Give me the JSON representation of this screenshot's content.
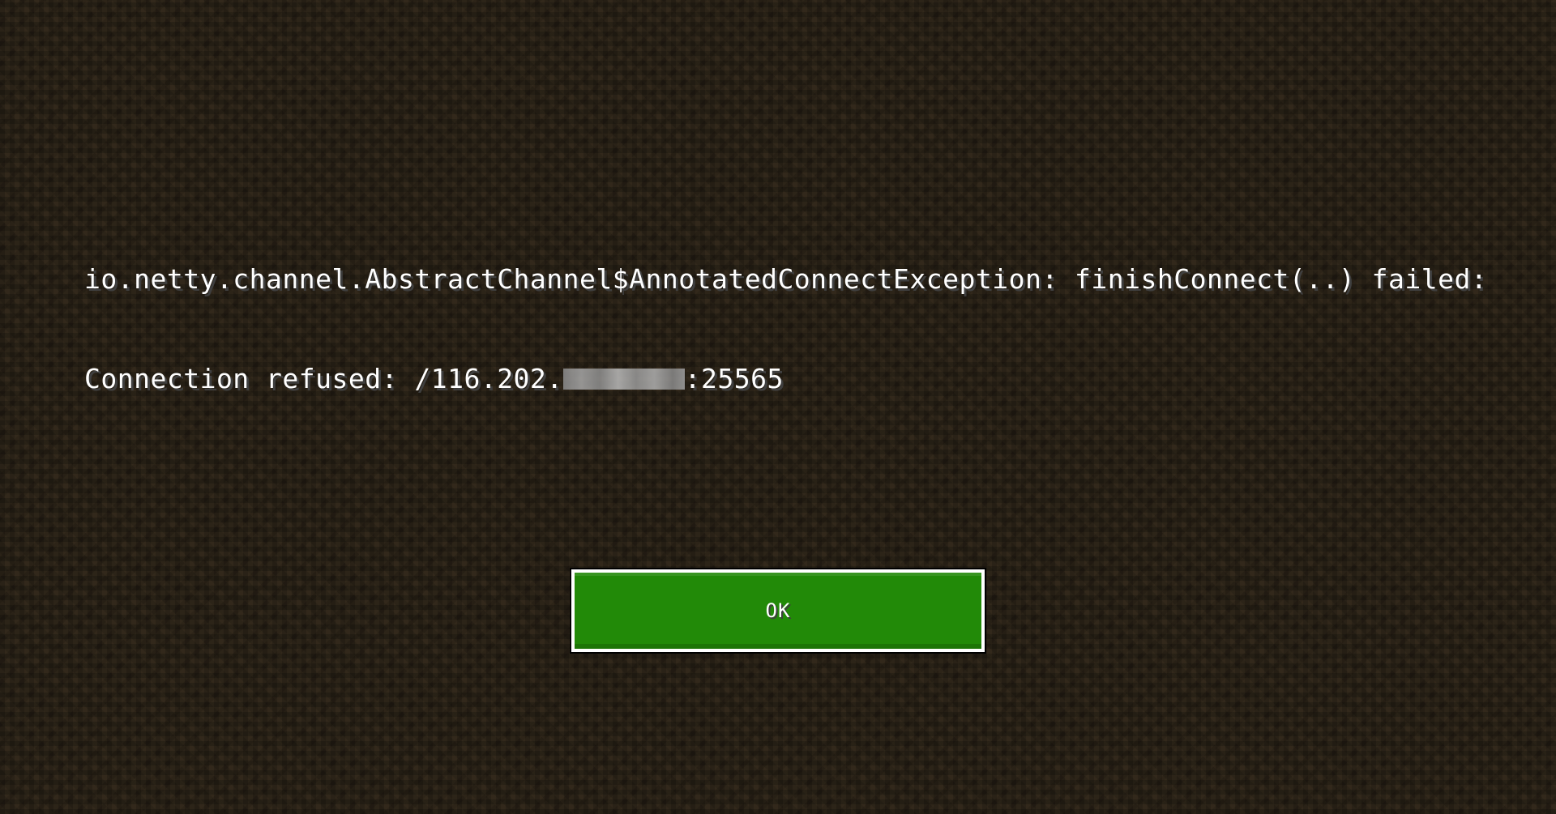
{
  "error": {
    "line1": "io.netty.channel.AbstractChannel$AnnotatedConnectException: finishConnect(..) failed:",
    "line2_prefix": "Connection refused: /116.202.",
    "line2_suffix": ":25565"
  },
  "button": {
    "label": "OK"
  },
  "colors": {
    "button_green": "#228a08",
    "text": "#ffffff"
  }
}
